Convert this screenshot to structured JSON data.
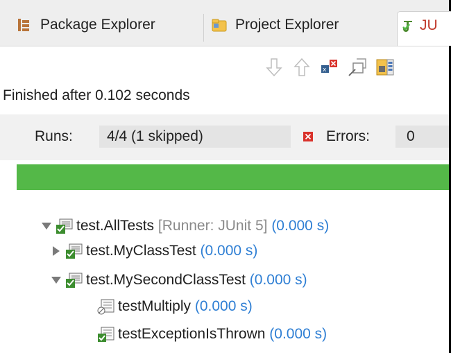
{
  "tabs": [
    {
      "label": "Package Explorer",
      "icon": "package-explorer-icon"
    },
    {
      "label": "Project Explorer",
      "icon": "project-explorer-icon"
    },
    {
      "label": "JU",
      "icon": "junit-icon"
    }
  ],
  "toolbar": {
    "items": [
      "next-failure-icon",
      "previous-failure-icon",
      "show-failures-only-icon",
      "scroll-lock-icon",
      "layout-icon"
    ]
  },
  "status": "Finished after 0.102 seconds",
  "counters": {
    "runs_label": "Runs:",
    "runs_value": "4/4 (1 skipped)",
    "errors_label": "Errors:",
    "errors_value": "0"
  },
  "progress": {
    "fraction": 1.0,
    "color": "#54b848"
  },
  "tree": [
    {
      "name": "test.AllTests",
      "runner": "[Runner: JUnit 5]",
      "time": "(0.000 s)",
      "expanded": true
    },
    {
      "name": "test.MyClassTest",
      "time": "(0.000 s)",
      "expanded": false
    },
    {
      "name": "test.MySecondClassTest",
      "time": "(0.000 s)",
      "expanded": true
    },
    {
      "name": "testMultiply",
      "time": "(0.000 s)",
      "skipped": true
    },
    {
      "name": "testExceptionIsThrown",
      "time": "(0.000 s)",
      "skipped": false
    }
  ],
  "colors": {
    "time": "#2f7fd4",
    "success": "#54b848",
    "error": "#d9322b"
  }
}
